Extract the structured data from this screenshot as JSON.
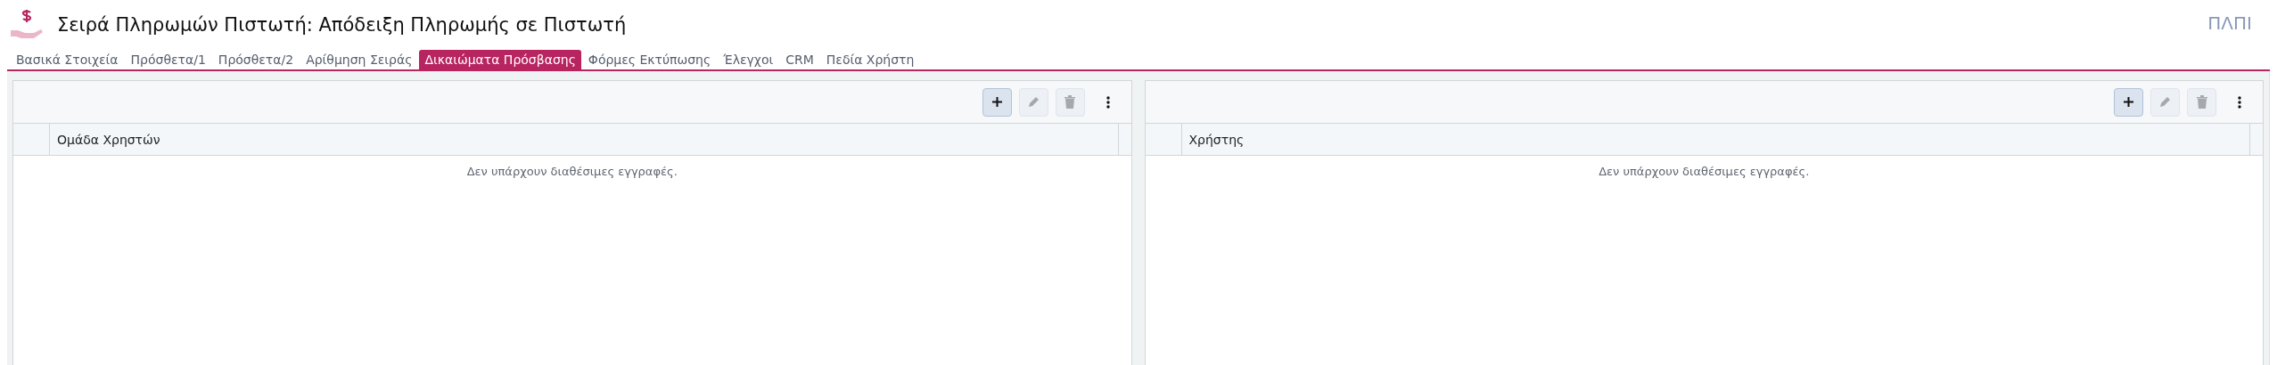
{
  "title": "Σειρά Πληρωμών Πιστωτή: Απόδειξη Πληρωμής σε Πιστωτή",
  "corner_text": "ΠΛΠΙ",
  "tabs": [
    {
      "label": "Βασικά Στοιχεία",
      "selected": false
    },
    {
      "label": "Πρόσθετα/1",
      "selected": false
    },
    {
      "label": "Πρόσθετα/2",
      "selected": false
    },
    {
      "label": "Αρίθμηση Σειράς",
      "selected": false
    },
    {
      "label": "Δικαιώματα Πρόσβασης",
      "selected": true
    },
    {
      "label": "Φόρμες Εκτύπωσης",
      "selected": false
    },
    {
      "label": "Έλεγχοι",
      "selected": false
    },
    {
      "label": "CRM",
      "selected": false
    },
    {
      "label": "Πεδία Χρήστη",
      "selected": false
    }
  ],
  "panels": [
    {
      "column": "Ομάδα Χρηστών",
      "empty_text": "Δεν υπάρχουν διαθέσιμες εγγραφές.",
      "toolbar": {
        "add_disabled": false,
        "edit_disabled": true,
        "delete_disabled": true
      }
    },
    {
      "column": "Χρήστης",
      "empty_text": "Δεν υπάρχουν διαθέσιμες εγγραφές.",
      "toolbar": {
        "add_disabled": false,
        "edit_disabled": true,
        "delete_disabled": true
      }
    }
  ]
}
